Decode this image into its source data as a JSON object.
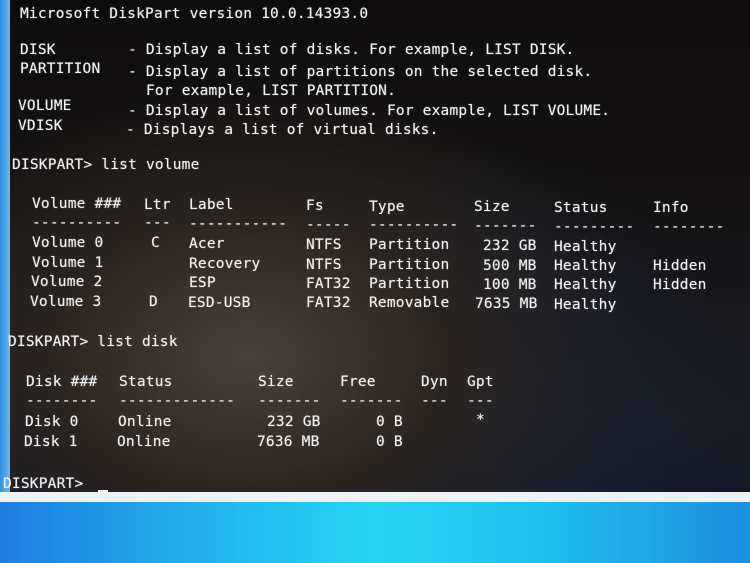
{
  "header": {
    "version_line": "Microsoft DiskPart version 10.0.14393.0"
  },
  "help": [
    {
      "cmd": "DISK",
      "desc": "- Display a list of disks. For example, LIST DISK."
    },
    {
      "cmd": "PARTITION",
      "desc": "- Display a list of partitions on the selected disk."
    },
    {
      "cmd": "",
      "desc": "For example, LIST PARTITION."
    },
    {
      "cmd": "VOLUME",
      "desc": "- Display a list of volumes. For example, LIST VOLUME."
    },
    {
      "cmd": "VDISK",
      "desc": "- Displays a list of virtual disks."
    }
  ],
  "volume_command": "DISKPART> list volume",
  "volume_table": {
    "headers": [
      "Volume ###",
      "Ltr",
      "Label",
      "Fs",
      "Type",
      "Size",
      "Status",
      "Info"
    ],
    "separators": [
      "----------",
      "---",
      "-----------",
      "-----",
      "----------",
      "-------",
      "---------",
      "--------"
    ],
    "rows": [
      [
        "Volume 0",
        "C",
        "Acer",
        "NTFS",
        "Partition",
        "232 GB",
        "Healthy",
        ""
      ],
      [
        "Volume 1",
        "",
        "Recovery",
        "NTFS",
        "Partition",
        "500 MB",
        "Healthy",
        "Hidden"
      ],
      [
        "Volume 2",
        "",
        "ESP",
        "FAT32",
        "Partition",
        "100 MB",
        "Healthy",
        "Hidden"
      ],
      [
        "Volume 3",
        "D",
        "ESD-USB",
        "FAT32",
        "Removable",
        "7635 MB",
        "Healthy",
        ""
      ]
    ]
  },
  "disk_command": "DISKPART> list disk",
  "disk_table": {
    "headers": [
      "Disk ###",
      "Status",
      "Size",
      "Free",
      "Dyn",
      "Gpt"
    ],
    "separators": [
      "--------",
      "-------------",
      "-------",
      "-------",
      "---",
      "---"
    ],
    "rows": [
      [
        "Disk 0",
        "Online",
        "232 GB",
        "0 B",
        "",
        "*"
      ],
      [
        "Disk 1",
        "Online",
        "7636 MB",
        "0 B",
        "",
        ""
      ]
    ]
  },
  "prompt": "DISKPART>"
}
